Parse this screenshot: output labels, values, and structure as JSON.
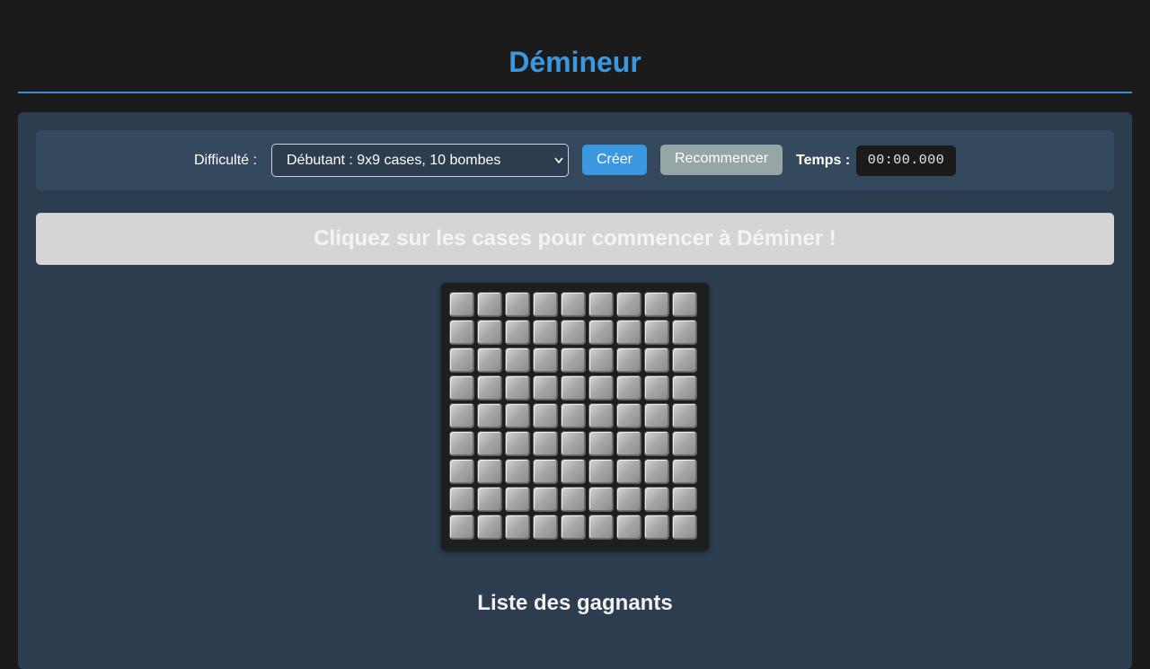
{
  "header": {
    "title": "Démineur"
  },
  "controls": {
    "difficulty_label": "Difficulté :",
    "difficulty_selected": "Débutant : 9x9 cases, 10 bombes",
    "create_label": "Créer",
    "restart_label": "Recommencer",
    "time_label": "Temps :",
    "time_value": "00:00.000"
  },
  "message": {
    "text": "Cliquez sur les cases pour commencer à Déminer !"
  },
  "board": {
    "rows": 9,
    "cols": 9,
    "state": "all-covered"
  },
  "winners": {
    "heading": "Liste des gagnants"
  },
  "colors": {
    "accent": "#3b97e0",
    "background": "#1b1b1b",
    "panel": "#2c3d50",
    "controls": "#34495e",
    "restart_button": "#96a5a6"
  }
}
